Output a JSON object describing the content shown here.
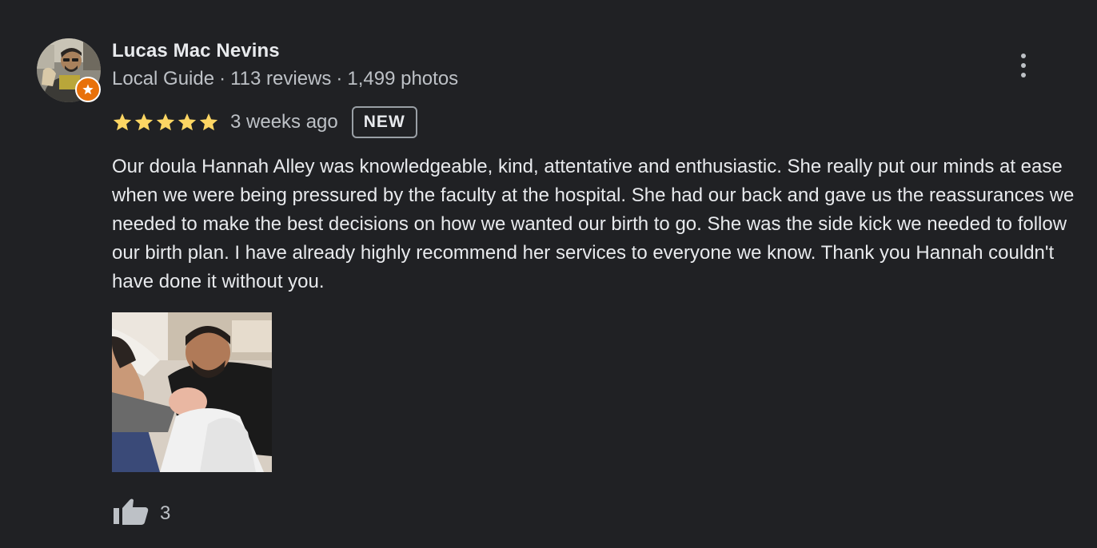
{
  "reviewer": {
    "name": "Lucas Mac Nevins",
    "badge": "Local Guide",
    "separator": "·",
    "reviews": "113 reviews",
    "photos": "1,499 photos",
    "avatar_icon": "user-avatar-photo",
    "badge_icon": "local-guide-star-icon"
  },
  "rating": {
    "stars": 5,
    "max_stars": 5,
    "date": "3 weeks ago",
    "new_badge": "NEW",
    "star_color": "#fdd663"
  },
  "review": {
    "text": "Our doula Hannah Alley was knowledgeable, kind, attentative and enthusiastic. She really put our minds at ease when we were being pressured by the faculty at the hospital. She had our back and gave us the reassurances we needed to make the best decisions on how we wanted our birth to go. She was the side kick we needed to follow our birth plan. I have already highly recommend her services to everyone we know. Thank you Hannah couldn't have done it without you."
  },
  "photo": {
    "icon": "review-photo"
  },
  "actions": {
    "menu_icon": "more-vert-icon",
    "like_icon": "thumbs-up-icon",
    "like_count": "3"
  },
  "colors": {
    "background": "#202124",
    "primary_text": "#e8eaed",
    "secondary_text": "#bdc1c6",
    "guide_badge": "#e8710a"
  }
}
